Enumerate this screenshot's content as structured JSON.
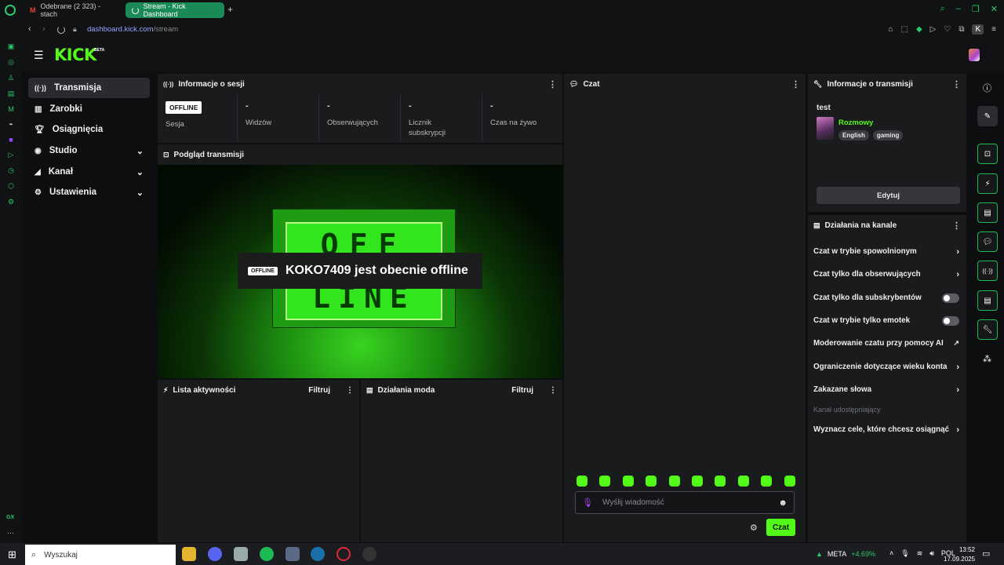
{
  "browser": {
    "tabs": [
      {
        "label": "Odebrane (2 323) - stach",
        "icon": "gmail-icon"
      },
      {
        "label": "Stream - Kick Dashboard",
        "icon": "kick-icon"
      }
    ],
    "url_domain": "dashboard.kick.com",
    "url_path": "/stream",
    "profile_initial": "K"
  },
  "header": {
    "logo": "KICK",
    "logo_badge": "BETA"
  },
  "nav": {
    "items": [
      {
        "label": "Transmisja",
        "icon": "broadcast-icon"
      },
      {
        "label": "Zarobki",
        "icon": "earnings-icon"
      },
      {
        "label": "Osiągnięcia",
        "icon": "trophy-icon"
      },
      {
        "label": "Studio",
        "icon": "studio-icon"
      },
      {
        "label": "Kanał",
        "icon": "channel-icon"
      },
      {
        "label": "Ustawienia",
        "icon": "gear-icon"
      }
    ]
  },
  "session": {
    "title": "Informacje o sesji",
    "badge": "OFFLINE",
    "stats": [
      {
        "value": "",
        "label": "Sesja"
      },
      {
        "value": "-",
        "label": "Widzów"
      },
      {
        "value": "-",
        "label": "Obserwujących"
      },
      {
        "value": "-",
        "label": "Licznik subskrypcji"
      },
      {
        "value": "-",
        "label": "Czas na żywo"
      }
    ]
  },
  "preview": {
    "title": "Podgląd transmisji",
    "overlay_badge": "OFFLINE",
    "overlay_text": "KOKO7409 jest obecnie offline",
    "art_top": "OFF",
    "art_bottom": "LINE"
  },
  "activity": {
    "title": "Lista aktywności",
    "filter": "Filtruj"
  },
  "modactions": {
    "title": "Działania moda",
    "filter": "Filtruj"
  },
  "chat": {
    "title": "Czat",
    "placeholder": "Wyślij wiadomość",
    "send_label": "Czat",
    "emote_count": 10
  },
  "stream_info": {
    "title": "Informacje o transmisji",
    "stream_title": "test",
    "category": "Rozmowy",
    "tags": [
      "English",
      "gaming"
    ],
    "edit_label": "Edytuj"
  },
  "channel_actions": {
    "title": "Działania na kanale",
    "items": [
      {
        "label": "Czat w trybie spowolnionym",
        "control": "chevron"
      },
      {
        "label": "Czat tylko dla obserwujących",
        "control": "chevron"
      },
      {
        "label": "Czat tylko dla subskrybentów",
        "control": "toggle"
      },
      {
        "label": "Czat w trybie tylko emotek",
        "control": "toggle"
      },
      {
        "label": "Moderowanie czatu przy pomocy AI",
        "control": "external"
      },
      {
        "label": "Ograniczenie dotyczące wieku konta",
        "control": "chevron"
      },
      {
        "label": "Zakazane słowa",
        "control": "chevron"
      },
      {
        "label": "Kanał udostępniający",
        "control": "none"
      },
      {
        "label": "Wyznacz cele, które chcesz osiągnąć",
        "control": "chevron"
      }
    ]
  },
  "taskbar": {
    "search_placeholder": "Wyszukaj",
    "ticker": "META",
    "ticker_change": "+4.69%",
    "lang": "POL",
    "time": "13:52",
    "date": "17.09.2025"
  },
  "colors": {
    "accent": "#53fc18",
    "panel": "#1a1b1d",
    "bg": "#0d0e10"
  }
}
